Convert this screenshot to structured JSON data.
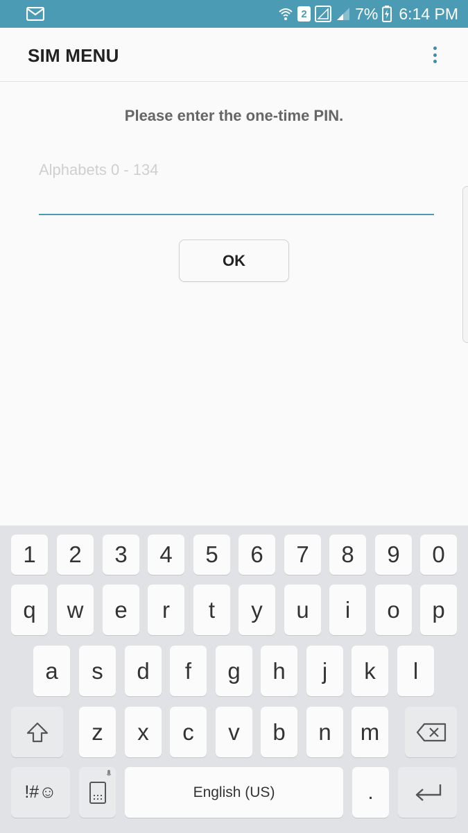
{
  "status_bar": {
    "mail_icon": "mail-icon",
    "sim_badge": "2",
    "battery_percent": "7%",
    "time": "6:14 PM"
  },
  "app_bar": {
    "title": "SIM MENU",
    "more_icon": "more-vert-icon"
  },
  "dialog": {
    "prompt": "Please enter the one-time PIN.",
    "input_placeholder": "Alphabets 0 - 134",
    "input_value": "",
    "ok_label": "OK"
  },
  "keyboard": {
    "row_numbers": [
      "1",
      "2",
      "3",
      "4",
      "5",
      "6",
      "7",
      "8",
      "9",
      "0"
    ],
    "row_top": [
      "q",
      "w",
      "e",
      "r",
      "t",
      "y",
      "u",
      "i",
      "o",
      "p"
    ],
    "row_middle": [
      "a",
      "s",
      "d",
      "f",
      "g",
      "h",
      "j",
      "k",
      "l"
    ],
    "row_bottom": [
      "z",
      "x",
      "c",
      "v",
      "b",
      "n",
      "m"
    ],
    "symbols_label": "!#☺",
    "space_label": "English (US)",
    "period_label": "."
  },
  "colors": {
    "status_bar": "#4a9bb3",
    "accent": "#4a9bb3",
    "keyboard_bg": "#e0e2e5",
    "key_bg": "#fbfbfb"
  }
}
